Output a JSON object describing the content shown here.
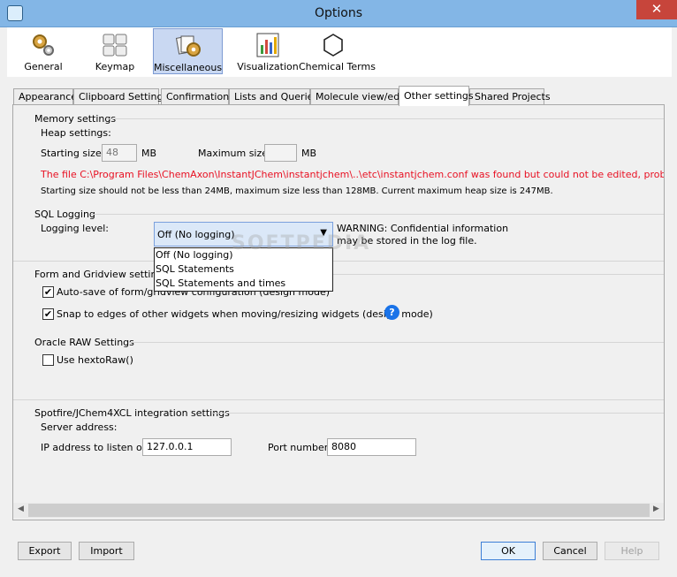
{
  "window": {
    "title": "Options",
    "close": "✕"
  },
  "toolbar": [
    {
      "label": "General",
      "icon": "gears-icon"
    },
    {
      "label": "Keymap",
      "icon": "keyboard-icon"
    },
    {
      "label": "Miscellaneous",
      "icon": "misc-gear-icon",
      "selected": true
    },
    {
      "label": "Visualization",
      "icon": "chart-icon"
    },
    {
      "label": "Chemical Terms",
      "icon": "hexagon-icon"
    }
  ],
  "tabs": [
    "Appearance",
    "Clipboard Settings",
    "Confirmations",
    "Lists and Queries",
    "Molecule view/edit",
    "Other settings",
    "Shared Projects"
  ],
  "active_tab": "Other settings",
  "memory": {
    "title": "Memory settings",
    "heap_label": "Heap settings:",
    "starting_label": "Starting size:",
    "starting_value": "48",
    "mb1": "MB",
    "max_label": "Maximum size:",
    "max_value": "",
    "mb2": "MB",
    "error": "The file C:\\Program Files\\ChemAxon\\InstantJChem\\instantjchem\\..\\etc\\instantjchem.conf was found but could not be edited, probably due to pern",
    "note": "Starting size should not be less than 24MB, maximum size less than 128MB. Current maximum heap size is 247MB."
  },
  "sql": {
    "title": "SQL Logging",
    "level_label": "Logging level:",
    "selected": "Off (No logging)",
    "options": [
      "Off (No logging)",
      "SQL Statements",
      "SQL Statements and times"
    ],
    "warning_line1": "WARNING: Confidential information",
    "warning_line2": "may be stored in the log file."
  },
  "form": {
    "title": "Form and Gridview settings",
    "autosave": "Auto-save of form/gridview configuration (design mode)",
    "snap": "Snap to edges of other widgets when moving/resizing widgets (design mode)",
    "help": "?"
  },
  "oracle": {
    "title": "Oracle RAW Settings",
    "hextoraw": "Use hextoRaw()"
  },
  "spotfire": {
    "title": "Spotfire/JChem4XCL integration settings",
    "server_label": "Server address:",
    "ip_label": "IP address to listen on:",
    "ip_value": "127.0.0.1",
    "port_label": "Port number:",
    "port_value": "8080"
  },
  "buttons": {
    "export": "Export",
    "import": "Import",
    "ok": "OK",
    "cancel": "Cancel",
    "help": "Help"
  },
  "watermark": "SOFTPEDIA"
}
